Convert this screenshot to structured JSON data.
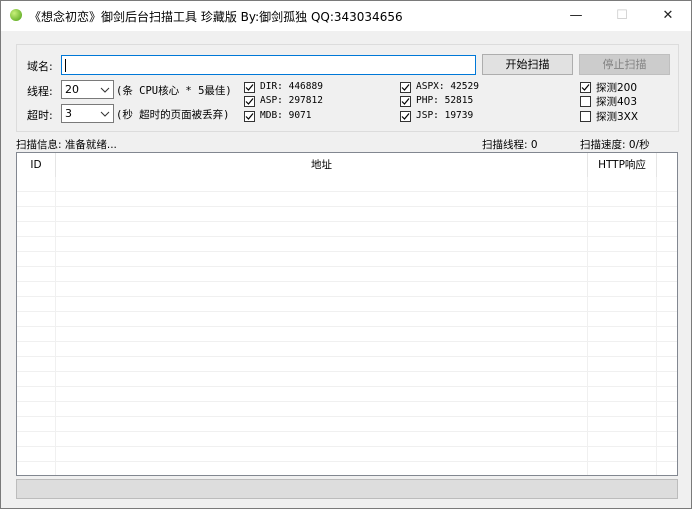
{
  "window": {
    "title": "《想念初恋》御剑后台扫描工具 珍藏版 By:御剑孤独 QQ:343034656",
    "minimize": "—",
    "maximize": "☐",
    "close": "✕"
  },
  "form": {
    "domain_label": "域名:",
    "domain_value": "",
    "start_button": "开始扫描",
    "stop_button": "停止扫描",
    "threads_label": "线程:",
    "threads_value": "20",
    "threads_hint": "(条 CPU核心 * 5最佳)",
    "timeout_label": "超时:",
    "timeout_value": "3",
    "timeout_hint": "(秒 超时的页面被丢弃)"
  },
  "dictionaries": [
    {
      "label": "DIR: 446889",
      "checked": true
    },
    {
      "label": "ASP: 297812",
      "checked": true
    },
    {
      "label": "MDB: 9071",
      "checked": true
    },
    {
      "label": "ASPX: 42529",
      "checked": true
    },
    {
      "label": "PHP: 52815",
      "checked": true
    },
    {
      "label": "JSP: 19739",
      "checked": true
    }
  ],
  "probes": [
    {
      "label": "探测200",
      "checked": true
    },
    {
      "label": "探测403",
      "checked": false
    },
    {
      "label": "探测3XX",
      "checked": false
    }
  ],
  "status": {
    "info": "扫描信息: 准备就绪...",
    "threads": "扫描线程: 0",
    "speed": "扫描速度: 0/秒"
  },
  "table": {
    "columns": [
      "ID",
      "地址",
      "HTTP响应"
    ],
    "rows": []
  },
  "statusbar": {
    "text": ""
  }
}
